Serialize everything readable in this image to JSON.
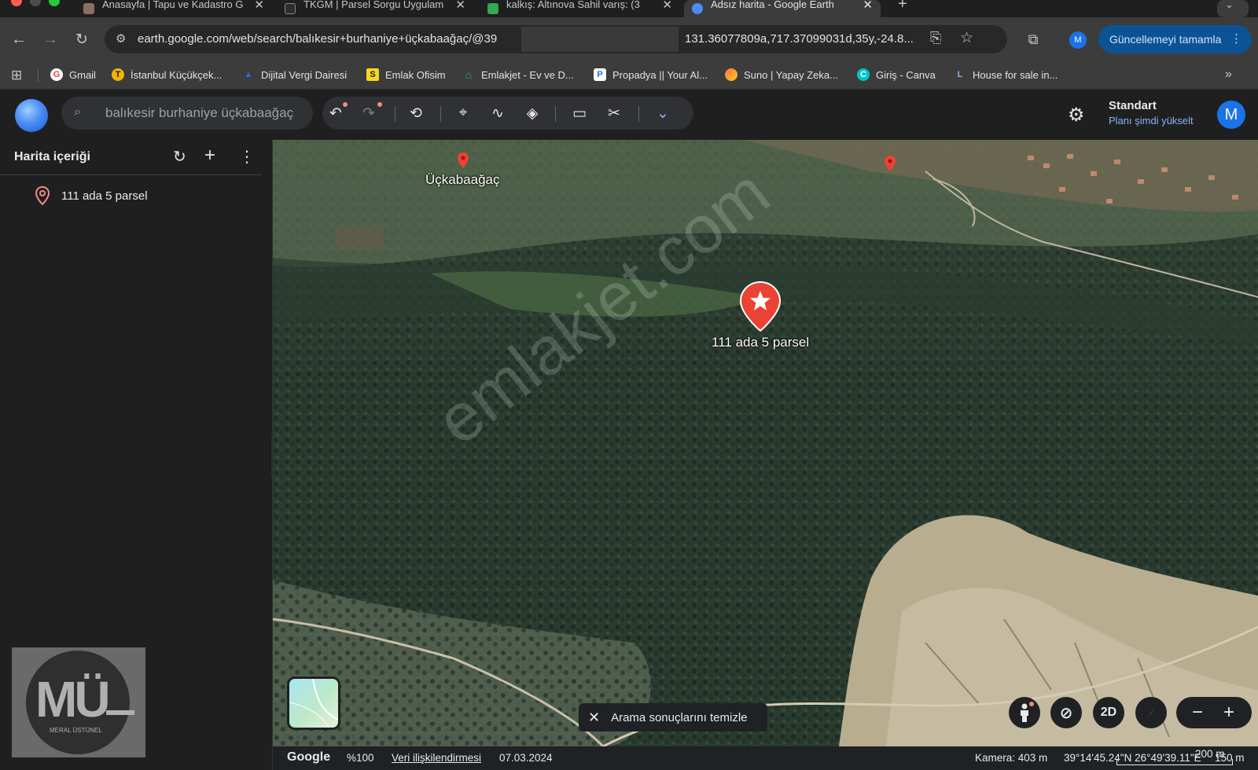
{
  "browser": {
    "tabs": [
      {
        "title": "Anasayfa | Tapu ve Kadastro G",
        "active": false
      },
      {
        "title": "TKGM | Parsel Sorgu Uygulam",
        "active": false
      },
      {
        "title": "kalkış: Altınova Sahil varış: (3",
        "active": false
      },
      {
        "title": "Adsız harita - Google Earth",
        "active": true
      }
    ],
    "url_left": "earth.google.com/web/search/balıkesir+burhaniye+üçkabaağaç/@39",
    "url_right": "131.36077809a,717.37099031d,35y,-24.8...",
    "profile_initial": "M",
    "update_button": "Güncellemeyi tamamla",
    "bookmarks": [
      {
        "label": "Gmail",
        "icon": "G",
        "color": "#ea4335"
      },
      {
        "label": "İstanbul Küçükçek...",
        "icon": "T",
        "color": "#f4b400"
      },
      {
        "label": "Dijital Vergi Dairesi",
        "icon": "▲",
        "color": "#1a73e8"
      },
      {
        "label": "Emlak Ofisim",
        "icon": "S",
        "color": "#f9d71c"
      },
      {
        "label": "Emlakjet - Ev ve D...",
        "icon": "⌂",
        "color": "#34a853"
      },
      {
        "label": "Propadya || Your Al...",
        "icon": "P",
        "color": "#ffffff"
      },
      {
        "label": "Suno | Yapay Zeka...",
        "icon": "●",
        "color": "#ff7043"
      },
      {
        "label": "Giriş - Canva",
        "icon": "C",
        "color": "#00c4cc"
      },
      {
        "label": "House for sale in...",
        "icon": "L",
        "color": "#4285f4"
      }
    ]
  },
  "earth": {
    "search_value": "balıkesir burhaniye üçkabaağaç",
    "plan_title": "Standart",
    "plan_link": "Planı şimdi yükselt",
    "user_initial": "M"
  },
  "sidebar": {
    "title": "Harita içeriği",
    "items": [
      {
        "label": "111 ada 5 parsel"
      }
    ]
  },
  "map": {
    "place_label": "Üçkabaağaç",
    "parcel_label": "111 ada 5 parsel",
    "watermark": "emlakjet.com",
    "clear_label": "Arama sonuçlarını temizle",
    "mode_2d": "2D"
  },
  "logo": {
    "letters": "MÜ",
    "name": "MERAL ÜSTÜNEL"
  },
  "status": {
    "brand": "Google",
    "zoom": "%100",
    "attribution": "Veri ilişkilendirmesi",
    "date": "07.03.2024",
    "scale": "200 m",
    "camera": "Kamera: 403 m",
    "coords": "39°14'45.24\"N 26°49'39.11\"E",
    "elevation": "150 m"
  }
}
